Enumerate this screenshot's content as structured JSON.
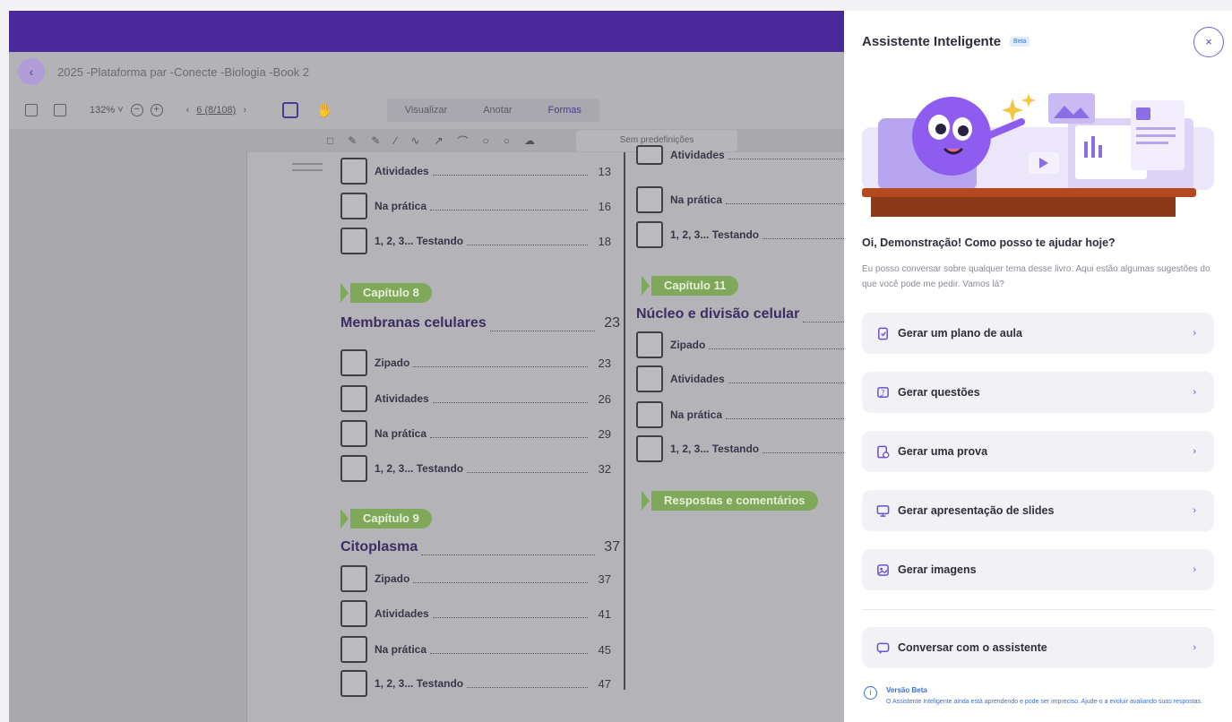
{
  "viewer": {
    "doc_title": "2025 -Plataforma par -Conecte -Biologia -Book 2",
    "zoom": "132% ˅",
    "page_indicator": "6 (8/108)",
    "tabs": [
      "Visualizar",
      "Anotar",
      "Formas"
    ],
    "preset_label": "Sem predefinições"
  },
  "toc": {
    "left": {
      "top_entries": [
        {
          "label": "Atividades",
          "page": "13"
        },
        {
          "label": "Na prática",
          "page": "16"
        },
        {
          "label": "1, 2, 3... Testando",
          "page": "18"
        }
      ],
      "chapters": [
        {
          "pill": "Capítulo 8",
          "title": "Membranas celulares",
          "page": "23",
          "entries": [
            {
              "label": "Zipado",
              "page": "23"
            },
            {
              "label": "Atividades",
              "page": "26"
            },
            {
              "label": "Na prática",
              "page": "29"
            },
            {
              "label": "1, 2, 3... Testando",
              "page": "32"
            }
          ]
        },
        {
          "pill": "Capítulo 9",
          "title": "Citoplasma",
          "page": "37",
          "entries": [
            {
              "label": "Zipado",
              "page": "37"
            },
            {
              "label": "Atividades",
              "page": "41"
            },
            {
              "label": "Na prática",
              "page": "45"
            },
            {
              "label": "1, 2, 3... Testando",
              "page": "47"
            }
          ]
        }
      ]
    },
    "right": {
      "top_entries": [
        {
          "label": "Atividades"
        },
        {
          "label": "Na prática"
        },
        {
          "label": "1, 2, 3... Testando"
        }
      ],
      "chapter": {
        "pill": "Capítulo 11",
        "title": "Núcleo e divisão celular",
        "entries": [
          {
            "label": "Zipado"
          },
          {
            "label": "Atividades"
          },
          {
            "label": "Na prática"
          },
          {
            "label": "1, 2, 3... Testando"
          }
        ]
      },
      "answers_pill": "Respostas e comentários"
    }
  },
  "assistant": {
    "title": "Assistente Inteligente",
    "badge": "Beta",
    "close": "×",
    "greeting": "Oi, Demonstração! Como posso te ajudar hoje?",
    "intro": "Eu posso conversar sobre qualquer tema desse livro. Aqui estão algumas sugestões do que você pode me pedir. Vamos lá?",
    "actions": [
      {
        "label": "Gerar um plano de aula",
        "icon": "document-icon"
      },
      {
        "label": "Gerar questões",
        "icon": "question-icon"
      },
      {
        "label": "Gerar uma prova",
        "icon": "exam-icon"
      },
      {
        "label": "Gerar apresentação de slides",
        "icon": "presentation-icon"
      },
      {
        "label": "Gerar imagens",
        "icon": "image-icon"
      }
    ],
    "chat_action": "Conversar com o assistente",
    "info_title": "Versão Beta",
    "info_text": "O Assistente Inteligente ainda está aprendendo e pode ser impreciso. Ajude-o a evoluir avaliando suas respostas.",
    "colors": {
      "brand": "#4a2a9a",
      "accent": "#6b4fd0",
      "chapter": "#7fa85a",
      "info": "#3a6fd8"
    }
  }
}
